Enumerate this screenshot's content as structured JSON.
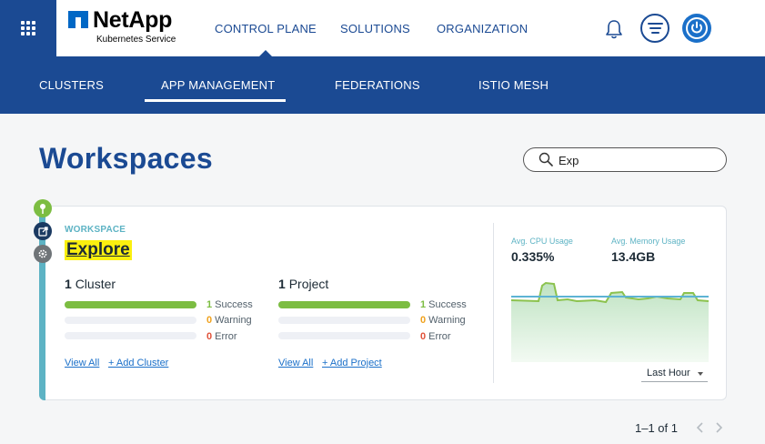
{
  "brand": {
    "name": "NetApp",
    "subtitle": "Kubernetes Service"
  },
  "topnav": [
    {
      "label": "CONTROL PLANE",
      "active": true
    },
    {
      "label": "SOLUTIONS",
      "active": false
    },
    {
      "label": "ORGANIZATION",
      "active": false
    }
  ],
  "icons": {
    "launcher": "apps-grid-icon",
    "bell": "bell-icon",
    "filter": "filter-lines-icon",
    "power": "power-icon",
    "search": "search-icon",
    "pin": "pin-icon",
    "external": "external-link-icon",
    "gear": "gear-icon"
  },
  "subnav": [
    {
      "label": "CLUSTERS",
      "active": false
    },
    {
      "label": "APP MANAGEMENT",
      "active": true
    },
    {
      "label": "FEDERATIONS",
      "active": false
    },
    {
      "label": "ISTIO MESH",
      "active": false
    }
  ],
  "page": {
    "title": "Workspaces"
  },
  "search": {
    "value": "Exp"
  },
  "workspace": {
    "label": "WORKSPACE",
    "name": "Explore",
    "clusters": {
      "count": "1",
      "noun": "Cluster",
      "success": "1",
      "success_label": "Success",
      "success_fraction": 1.0,
      "warning": "0",
      "warning_label": "Warning",
      "warning_fraction": 0,
      "error": "0",
      "error_label": "Error",
      "error_fraction": 0,
      "view_all": "View All",
      "add": "+ Add Cluster"
    },
    "projects": {
      "count": "1",
      "noun": "Project",
      "success": "1",
      "success_label": "Success",
      "success_fraction": 1.0,
      "warning": "0",
      "warning_label": "Warning",
      "warning_fraction": 0,
      "error": "0",
      "error_label": "Error",
      "error_fraction": 0,
      "view_all": "View All",
      "add": "+ Add Project"
    },
    "metrics": {
      "cpu_label": "Avg. CPU Usage",
      "cpu_value": "0.335%",
      "mem_label": "Avg. Memory Usage",
      "mem_value": "13.4GB",
      "time_range": "Last Hour"
    }
  },
  "pagination": {
    "text": "1–1 of 1"
  },
  "colors": {
    "brand_blue": "#1b4a93",
    "accent_teal": "#5db3c4",
    "success": "#7cbd42",
    "warning": "#f0a21e",
    "error": "#e0523a",
    "highlight": "#fbf00f"
  }
}
